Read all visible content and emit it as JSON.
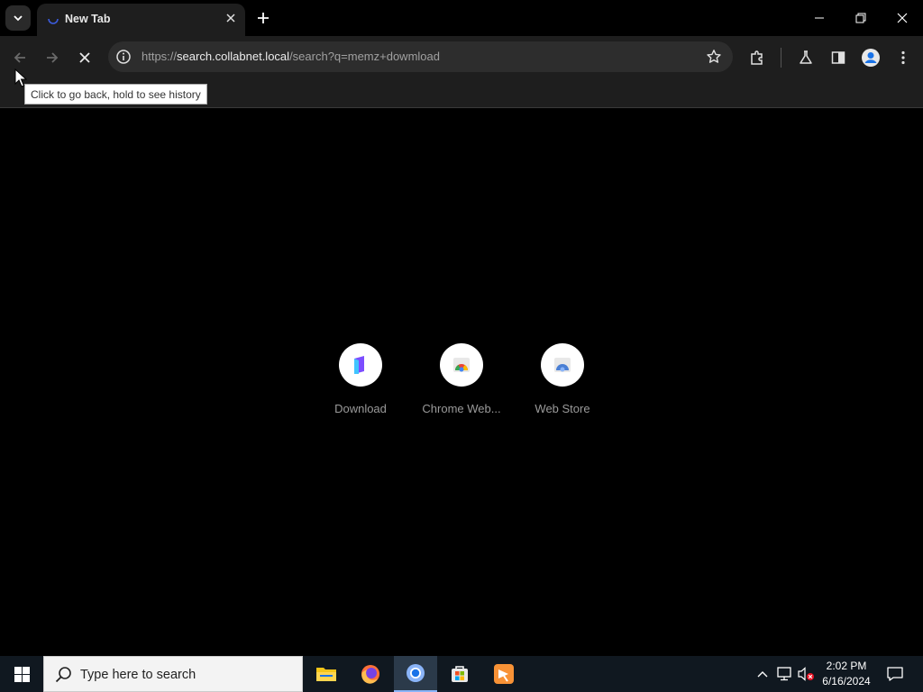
{
  "browser": {
    "tab": {
      "title": "New Tab"
    },
    "omnibox": {
      "url_scheme": "https://",
      "url_host": "search.collabnet.local",
      "url_rest": "/search?q=memz+dowmload"
    },
    "tooltip": "Click to go back, hold to see history"
  },
  "content": {
    "shortcuts": [
      {
        "label": "Download",
        "icon": "download-shortcut-icon"
      },
      {
        "label": "Chrome Web...",
        "icon": "chrome-web-store-icon"
      },
      {
        "label": "Web Store",
        "icon": "web-store-icon"
      }
    ]
  },
  "taskbar": {
    "search_placeholder": "Type here to search",
    "apps": [
      "file-explorer-icon",
      "firefox-icon",
      "chrome-icon",
      "microsoft-store-icon",
      "app-icon"
    ],
    "time": "2:02 PM",
    "date": "6/16/2024"
  },
  "colors": {
    "background": "#000000",
    "toolbar": "#1e1e1e",
    "omnibox": "#2d2d2d",
    "taskbar": "#101820",
    "accent": "#8ab4f8"
  }
}
